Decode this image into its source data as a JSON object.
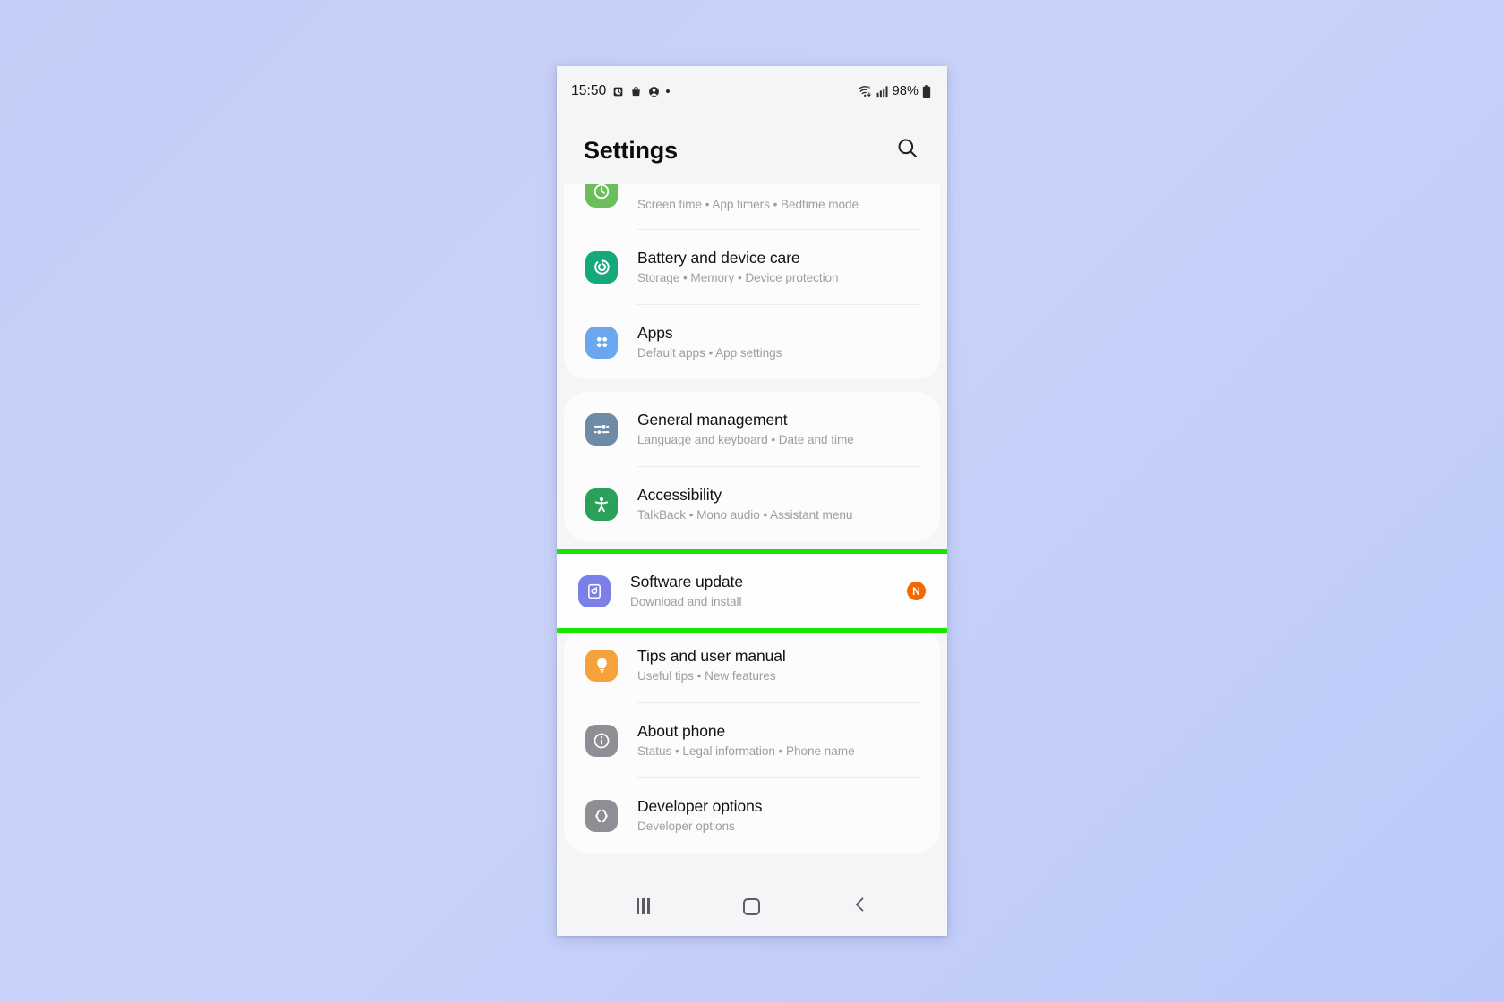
{
  "status_bar": {
    "time": "15:50",
    "left_icons": [
      "alarm-icon",
      "bag-icon",
      "account-icon",
      "dot-indicator"
    ],
    "right_icons": [
      "wifi-6-icon",
      "signal-bars-icon"
    ],
    "battery_percent": "98%",
    "battery_icon": "battery-full-icon"
  },
  "header": {
    "title": "Settings",
    "search_icon": "search-icon"
  },
  "colors": {
    "highlight": "#16e600",
    "badge": "#f56a00",
    "battery": "#14a87b",
    "apps": "#6ba7ef",
    "general": "#6e8aa6",
    "accessibility": "#2ba05b",
    "software": "#7b7fe8",
    "tips": "#f5a23c",
    "about": "#8d8f94",
    "developer": "#8d8f94",
    "digital_wellbeing": "#6bbf59"
  },
  "groups": [
    {
      "id": "group-1",
      "highlighted": false,
      "items": [
        {
          "name": "digital-wellbeing",
          "title": "",
          "subtitle": "Screen time  •  App timers  •  Bedtime mode",
          "icon": "wellbeing-icon",
          "icon_color": "#6bbf59",
          "partial": true,
          "badge": ""
        },
        {
          "name": "battery-and-device-care",
          "title": "Battery and device care",
          "subtitle": "Storage  •  Memory  •  Device protection",
          "icon": "battery-care-icon",
          "icon_color": "#14a87b",
          "partial": false,
          "badge": ""
        },
        {
          "name": "apps",
          "title": "Apps",
          "subtitle": "Default apps  •  App settings",
          "icon": "apps-grid-icon",
          "icon_color": "#6ba7ef",
          "partial": false,
          "badge": ""
        }
      ]
    },
    {
      "id": "group-2",
      "highlighted": false,
      "items": [
        {
          "name": "general-management",
          "title": "General management",
          "subtitle": "Language and keyboard  •  Date and time",
          "icon": "sliders-icon",
          "icon_color": "#6e8aa6",
          "partial": false,
          "badge": ""
        },
        {
          "name": "accessibility",
          "title": "Accessibility",
          "subtitle": "TalkBack  •  Mono audio  •  Assistant menu",
          "icon": "accessibility-person-icon",
          "icon_color": "#2ba05b",
          "partial": false,
          "badge": ""
        }
      ]
    },
    {
      "id": "group-3",
      "highlighted": true,
      "items": [
        {
          "name": "software-update",
          "title": "Software update",
          "subtitle": "Download and install",
          "icon": "software-update-icon",
          "icon_color": "#7b7fe8",
          "partial": false,
          "badge": "N"
        }
      ]
    },
    {
      "id": "group-4",
      "highlighted": false,
      "items": [
        {
          "name": "tips-and-user-manual",
          "title": "Tips and user manual",
          "subtitle": "Useful tips  •  New features",
          "icon": "lightbulb-icon",
          "icon_color": "#f5a23c",
          "partial": false,
          "badge": ""
        },
        {
          "name": "about-phone",
          "title": "About phone",
          "subtitle": "Status  •  Legal information  •  Phone name",
          "icon": "info-icon",
          "icon_color": "#8d8f94",
          "partial": false,
          "badge": ""
        },
        {
          "name": "developer-options",
          "title": "Developer options",
          "subtitle": "Developer options",
          "icon": "braces-icon",
          "icon_color": "#8d8f94",
          "partial": false,
          "badge": ""
        }
      ]
    }
  ],
  "nav_bar": {
    "recents_icon": "recents-icon",
    "home_icon": "home-icon",
    "back_icon": "back-chevron-icon"
  }
}
